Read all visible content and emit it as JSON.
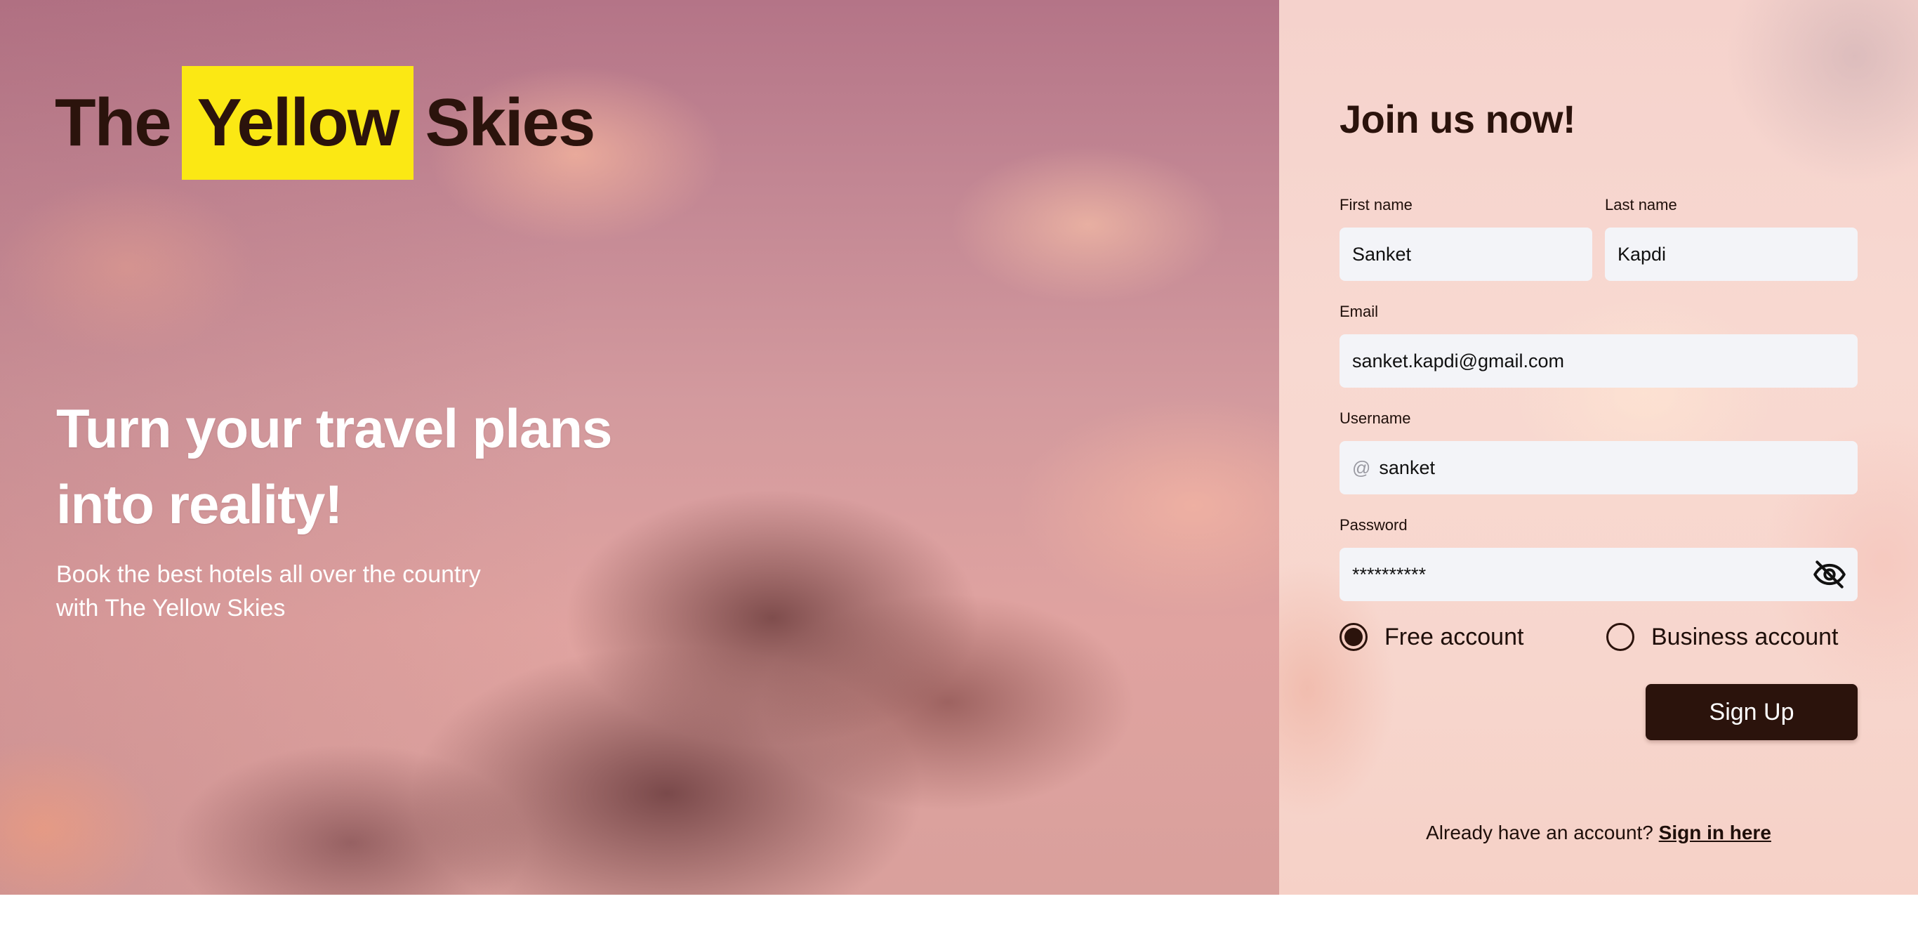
{
  "brand": {
    "prefix": "The",
    "highlight": "Yellow",
    "suffix": "Skies",
    "highlight_color": "#fbe814",
    "text_color": "#2b130c"
  },
  "hero": {
    "headline_line1": "Turn your travel plans",
    "headline_line2": "into reality!",
    "subtext_line1": "Book the best hotels all over the country",
    "subtext_line2": "with The Yellow Skies"
  },
  "form": {
    "title": "Join us now!",
    "first_name": {
      "label": "First name",
      "value": "Sanket"
    },
    "last_name": {
      "label": "Last name",
      "value": "Kapdi"
    },
    "email": {
      "label": "Email",
      "value": "sanket.kapdi@gmail.com"
    },
    "username": {
      "label": "Username",
      "prefix": "@",
      "value": "sanket"
    },
    "password": {
      "label": "Password",
      "value": "**********",
      "toggle_icon": "eye-off-icon"
    },
    "account_types": [
      {
        "label": "Free account",
        "selected": true
      },
      {
        "label": "Business account",
        "selected": false
      }
    ],
    "submit_label": "Sign Up",
    "signin_prompt": "Already have an account?",
    "signin_link": "Sign in here",
    "button_color": "#2b130c",
    "input_bg": "#f3f4f8"
  }
}
